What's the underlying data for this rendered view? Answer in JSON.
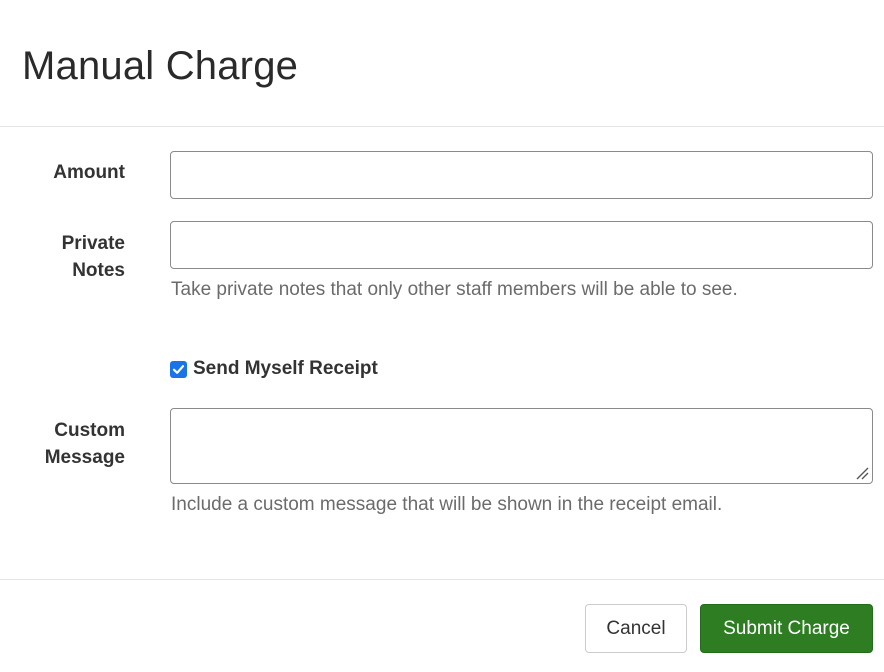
{
  "dialog": {
    "title": "Manual Charge"
  },
  "form": {
    "amount": {
      "label": "Amount",
      "value": "",
      "placeholder": ""
    },
    "private_notes": {
      "label_line1": "Private",
      "label_line2": "Notes",
      "value": "",
      "placeholder": "",
      "help": "Take private notes that only other staff members will be able to see."
    },
    "send_receipt": {
      "label": "Send Myself Receipt",
      "checked": true
    },
    "custom_message": {
      "label_line1": "Custom",
      "label_line2": "Message",
      "value": "",
      "placeholder": "",
      "help": "Include a custom message that will be shown in the receipt email."
    }
  },
  "footer": {
    "cancel_label": "Cancel",
    "submit_label": "Submit Charge"
  },
  "colors": {
    "submit_bg": "#2e7d23",
    "checkbox_accent": "#1a73e8",
    "help_text": "#6b6b6b"
  }
}
